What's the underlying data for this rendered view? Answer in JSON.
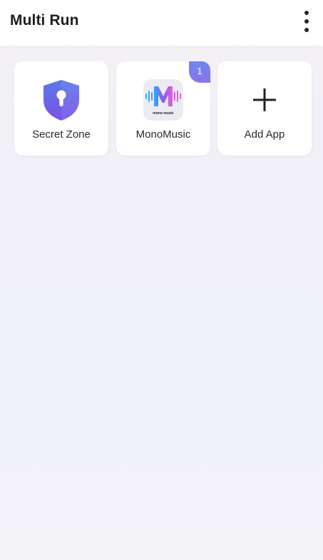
{
  "app_bar": {
    "title": "Multi Run",
    "more_icon": "more-vertical-icon"
  },
  "apps": [
    {
      "label": "Secret Zone",
      "icon": "shield-lock-icon",
      "colors": {
        "top": "#5b74e8",
        "bottom": "#7c55e6"
      }
    },
    {
      "label": "MonoMusic",
      "icon": "mono-music-logo",
      "logo_caption": "mono music",
      "badge": "1",
      "colors": {
        "gradient_start": "#2fa8f5",
        "gradient_mid": "#8a5cf0",
        "gradient_end": "#e25ee0"
      }
    },
    {
      "label": "Add App",
      "icon": "plus-icon"
    }
  ],
  "theme": {
    "accent": "#6f86ee",
    "background": "#f1f0f7",
    "card": "#ffffff"
  }
}
